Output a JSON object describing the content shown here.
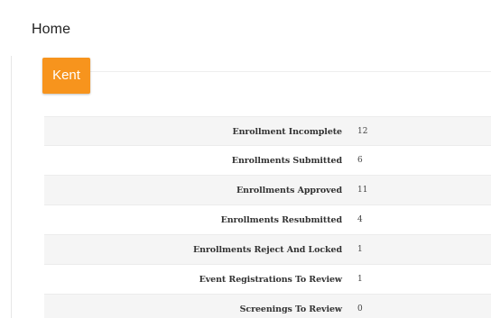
{
  "page": {
    "title": "Home"
  },
  "organization": {
    "button_label": "Kent",
    "accent_color": "#f7941d"
  },
  "status_rows": [
    {
      "label": "Enrollment Incomplete",
      "value": "12"
    },
    {
      "label": "Enrollments Submitted",
      "value": "6"
    },
    {
      "label": "Enrollments Approved",
      "value": "11"
    },
    {
      "label": "Enrollments Resubmitted",
      "value": "4"
    },
    {
      "label": "Enrollments Reject And Locked",
      "value": "1"
    },
    {
      "label": "Event Registrations To Review",
      "value": "1"
    },
    {
      "label": "Screenings To Review",
      "value": "0"
    }
  ]
}
